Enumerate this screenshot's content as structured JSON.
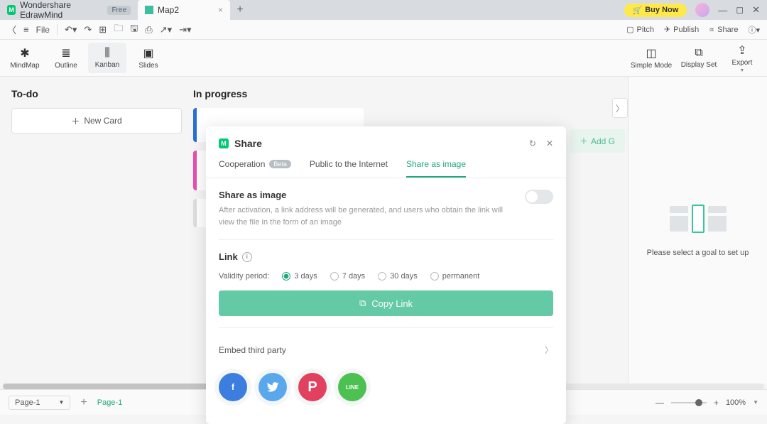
{
  "titlebar": {
    "app": "Wondershare EdrawMind",
    "free": "Free",
    "map_tab": "Map2",
    "buynow": "Buy Now"
  },
  "toolbar": {
    "file": "File",
    "pitch": "Pitch",
    "publish": "Publish",
    "share": "Share"
  },
  "ribbon": {
    "mindmap": "MindMap",
    "outline": "Outline",
    "kanban": "Kanban",
    "slides": "Slides",
    "simple": "Simple Mode",
    "display": "Display Set",
    "export": "Export"
  },
  "kanban": {
    "todo": "To-do",
    "inprogress": "In progress",
    "newcard": "New Card",
    "addg": "Add G"
  },
  "rightpanel": {
    "msg": "Please select a goal to set up"
  },
  "status": {
    "page": "Page-1",
    "page_active": "Page-1",
    "zoom": "100%"
  },
  "modal": {
    "title": "Share",
    "tabs": {
      "coop": "Cooperation",
      "beta": "Beta",
      "public": "Public to the Internet",
      "image": "Share as image"
    },
    "section": {
      "title": "Share as image",
      "desc": "After activation, a link address will be generated, and users who obtain the link will view the file in the form of an image"
    },
    "link": {
      "title": "Link",
      "validity": "Validity period:",
      "d3": "3 days",
      "d7": "7 days",
      "d30": "30 days",
      "perm": "permanent",
      "copy": "Copy Link"
    },
    "embed": "Embed third party"
  }
}
